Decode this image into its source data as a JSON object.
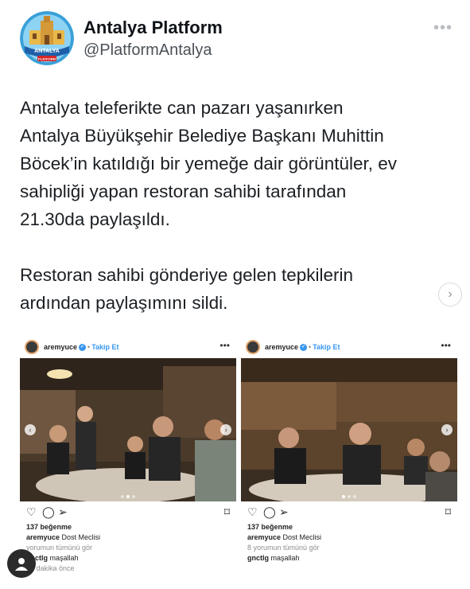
{
  "account": {
    "name": "Antalya Platform",
    "handle": "@PlatformAntalya",
    "logo_text": "ANTALYA",
    "logo_subtext": "PLATFORM",
    "more": "•••"
  },
  "tweet": {
    "paragraph1": "Antalya teleferikte can pazarı yaşanırken\nAntalya Büyükşehir Belediye Başkanı Muhittin\nBöcek’in katıldığı bir yemeğe dair görüntüler, ev\nsahipliği yapan restoran sahibi tarafından\n21.30da paylaşıldı.",
    "paragraph2": "Restoran sahibi  gönderiye gelen tepkilerin\nardından paylaşımını sildi."
  },
  "gallery": {
    "next_icon": "chevron-right-icon",
    "next_glyph": "›"
  },
  "posts": [
    {
      "username": "aremyuce",
      "follow": "Takip Et",
      "more": "•••",
      "likes": "137 beğenme",
      "caption_user": "aremyuce",
      "caption_text": "Dost Meclisi",
      "comments_link": "yorumun tümünü gör",
      "comment_user": "gnctlg",
      "comment_text": "maşallah",
      "time": "38 dakika önce"
    },
    {
      "username": "aremyuce",
      "follow": "Takip Et",
      "more": "•••",
      "likes": "137 beğenme",
      "caption_user": "aremyuce",
      "caption_text": "Dost Meclisi",
      "comments_link": "8 yorumun tümünü gör",
      "comment_user": "gnctlg",
      "comment_text": "maşallah"
    }
  ],
  "colors": {
    "text": "#0f1419",
    "secondary": "#4b5157",
    "instagram_blue": "#3897f0"
  }
}
